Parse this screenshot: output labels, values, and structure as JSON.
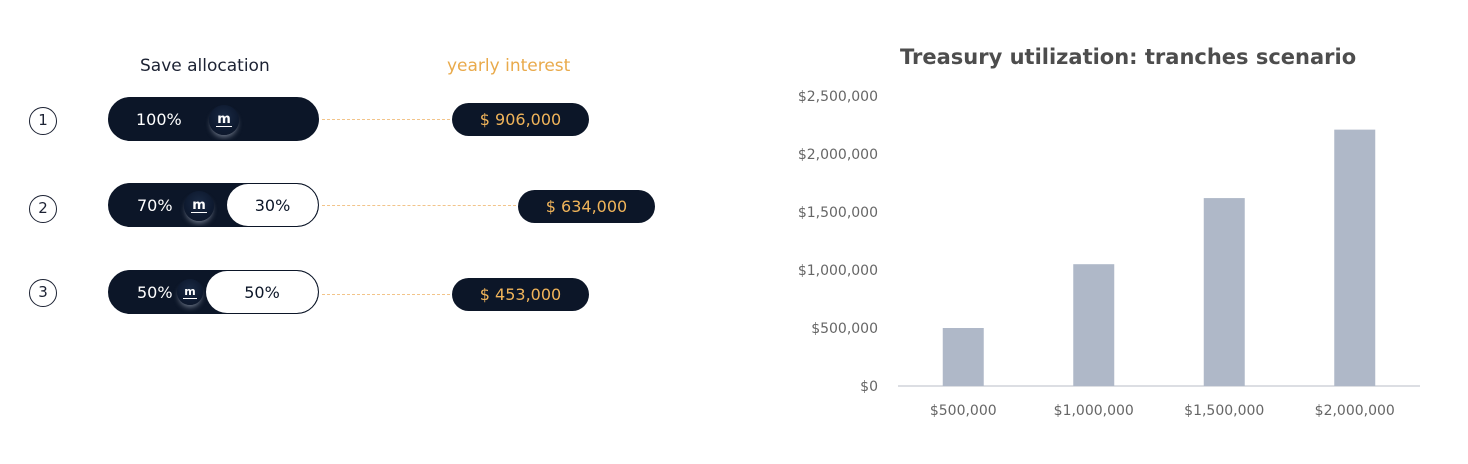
{
  "allocation": {
    "header_save": "Save allocation",
    "header_yearly": "yearly interest",
    "logo_glyph": "m",
    "rows": [
      {
        "number": "1",
        "dark_pct": "100%",
        "light_pct": "",
        "interest": "$ 906,000"
      },
      {
        "number": "2",
        "dark_pct": "70%",
        "light_pct": "30%",
        "interest": "$ 634,000"
      },
      {
        "number": "3",
        "dark_pct": "50%",
        "light_pct": "50%",
        "interest": "$ 453,000"
      }
    ],
    "colors": {
      "navy": "#0c1628",
      "gold": "#f0b45a",
      "header_gold": "#e9aa4b"
    }
  },
  "chart_data": {
    "type": "bar",
    "title": "Treasury utilization: tranches scenario",
    "categories": [
      "$500,000",
      "$1,000,000",
      "$1,500,000",
      "$2,000,000"
    ],
    "values": [
      500000,
      1050000,
      1620000,
      2210000
    ],
    "y_ticks": [
      "$0",
      "$500,000",
      "$1,000,000",
      "$1,500,000",
      "$2,000,000",
      "$2,500,000"
    ],
    "ylim": [
      0,
      2500000
    ],
    "xlabel": "",
    "ylabel": "",
    "grid": false,
    "bar_color": "#afb8c8"
  }
}
